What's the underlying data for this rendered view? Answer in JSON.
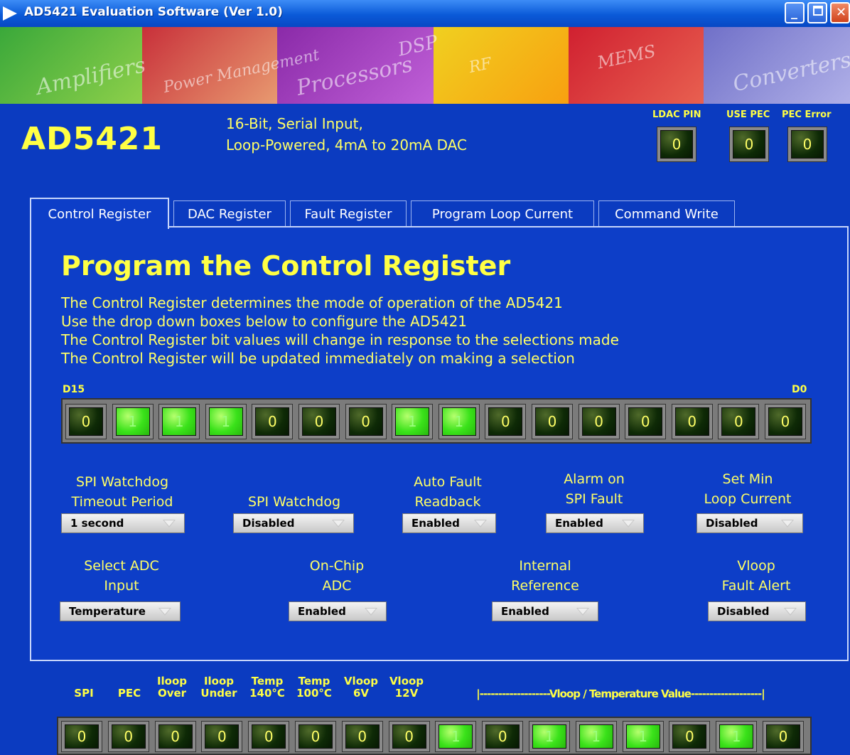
{
  "window": {
    "title": "AD5421 Evaluation Software (Ver 1.0)"
  },
  "banner": {
    "segments": [
      "Amplifiers",
      "Power Management",
      "Processors",
      "DSP",
      "RF",
      "MEMS",
      "Converters"
    ]
  },
  "header": {
    "chip": "AD5421",
    "desc_line1": "16-Bit, Serial Input,",
    "desc_line2": "Loop-Powered, 4mA to 20mA DAC",
    "indicators": [
      {
        "label": "LDAC PIN",
        "value": "0"
      },
      {
        "label": "USE PEC",
        "value": "0"
      },
      {
        "label": "PEC Error",
        "value": "0"
      }
    ]
  },
  "tabs": [
    {
      "label": "Control Register",
      "active": true
    },
    {
      "label": "DAC Register",
      "active": false
    },
    {
      "label": "Fault Register",
      "active": false
    },
    {
      "label": "Program Loop Current",
      "active": false
    },
    {
      "label": "Command Write",
      "active": false
    }
  ],
  "panel": {
    "title": "Program the Control Register",
    "lines": [
      "The Control Register determines the mode of operation of the AD5421",
      "Use the drop down boxes below to configure the AD5421",
      "The Control Register bit values will change in response to the selections made",
      "The Control Register will be updated immediately on making a selection"
    ],
    "msb_label": "D15",
    "lsb_label": "D0",
    "bits": [
      "0",
      "1",
      "1",
      "1",
      "0",
      "0",
      "0",
      "1",
      "1",
      "0",
      "0",
      "0",
      "0",
      "0",
      "0",
      "0"
    ],
    "controls_row1": [
      {
        "label1": "SPI Watchdog",
        "label2": "Timeout Period",
        "value": "1 second"
      },
      {
        "label1": "",
        "label2": "SPI Watchdog",
        "value": "Disabled"
      },
      {
        "label1": "Auto Fault",
        "label2": "Readback",
        "value": "Enabled"
      },
      {
        "label1": "Alarm on",
        "label2": "SPI Fault",
        "value": "Enabled"
      },
      {
        "label1": "Set Min",
        "label2": "Loop Current",
        "value": "Disabled"
      }
    ],
    "controls_row2": [
      {
        "label1": "Select ADC",
        "label2": "Input",
        "value": "Temperature"
      },
      {
        "label1": "On-Chip",
        "label2": "ADC",
        "value": "Enabled"
      },
      {
        "label1": "Internal",
        "label2": "Reference",
        "value": "Enabled"
      },
      {
        "label1": "Vloop",
        "label2": "Fault Alert",
        "value": "Disabled"
      }
    ]
  },
  "status": {
    "labels": [
      {
        "l1": "",
        "l2": "SPI"
      },
      {
        "l1": "",
        "l2": "PEC"
      },
      {
        "l1": "Iloop",
        "l2": "Over"
      },
      {
        "l1": "Iloop",
        "l2": "Under"
      },
      {
        "l1": "Temp",
        "l2": "140°C"
      },
      {
        "l1": "Temp",
        "l2": "100°C"
      },
      {
        "l1": "Vloop",
        "l2": "6V"
      },
      {
        "l1": "Vloop",
        "l2": "12V"
      }
    ],
    "range_label": "|-------------------Vloop / Temperature Value-------------------|",
    "bits": [
      "0",
      "0",
      "0",
      "0",
      "0",
      "0",
      "0",
      "0",
      "1",
      "0",
      "1",
      "1",
      "1",
      "0",
      "1",
      "0"
    ]
  },
  "colors": {
    "background": "#0b3bc0",
    "label_yellow": "#ffff44",
    "led_on": "#3ae21a",
    "led_off": "#0e2a06"
  }
}
